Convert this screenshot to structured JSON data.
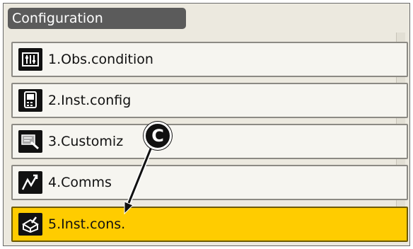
{
  "window": {
    "title": "Configuration"
  },
  "menu": {
    "items": [
      {
        "label": "1.Obs.condition",
        "icon": "obs-condition-icon",
        "selected": false
      },
      {
        "label": "2.Inst.config",
        "icon": "instrument-icon",
        "selected": false
      },
      {
        "label": "3.Customiz",
        "icon": "customize-icon",
        "selected": false
      },
      {
        "label": "4.Comms",
        "icon": "comms-icon",
        "selected": false
      },
      {
        "label": "5.Inst.cons.",
        "icon": "inst-cons-icon",
        "selected": true
      }
    ]
  },
  "callout": {
    "letter": "C"
  },
  "colors": {
    "highlight": "#ffcc00",
    "title_bar": "#5b5b5b",
    "item_bg": "#f6f5f0"
  }
}
